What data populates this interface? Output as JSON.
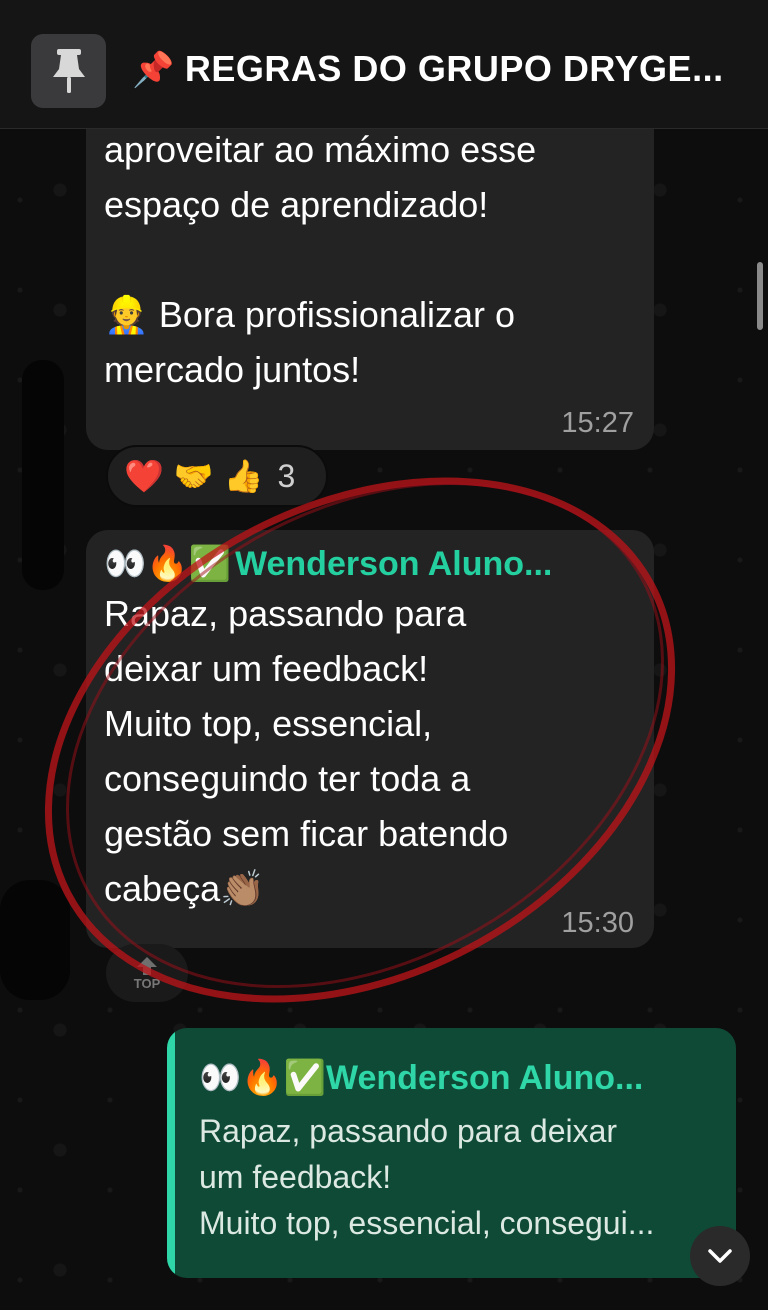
{
  "pinned": {
    "pin_emoji": "📌",
    "title": "REGRAS DO GRUPO DRYGE..."
  },
  "messages": [
    {
      "text_visible": "aproveitar ao máximo esse\nespaço de aprendizado!\n\n👷 Bora profissionalizar o\nmercado juntos!",
      "time": "15:27",
      "reactions": {
        "emojis": [
          "❤️",
          "🤝",
          "👍"
        ],
        "count": "3"
      }
    },
    {
      "sender_emojis": "👀🔥✅",
      "sender": "Wenderson  Aluno...",
      "text": "Rapaz, passando para\ndeixar um feedback!\nMuito top, essencial,\nconseguindo ter toda a\ngestão sem ficar batendo\ncabeça👏🏽",
      "time": "15:30"
    }
  ],
  "top_button": {
    "label": "TOP"
  },
  "reply": {
    "sender_emojis": "👀🔥✅",
    "sender": "Wenderson  Aluno...",
    "text": "Rapaz, passando para deixar\num feedback!\nMuito top, essencial, consegui..."
  },
  "colors": {
    "bubble": "#232323",
    "accent_green": "#2fd6a8",
    "reply_bg": "#0f4a36",
    "annotation_red": "#c0141a"
  }
}
